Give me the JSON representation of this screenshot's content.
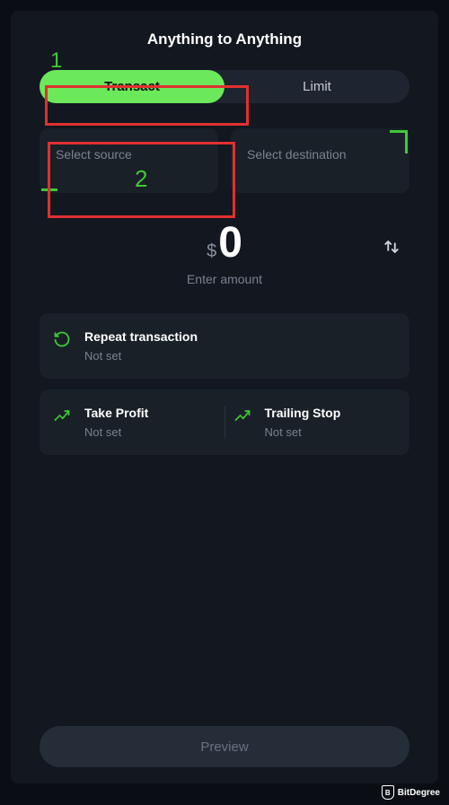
{
  "header": {
    "title": "Anything to Anything"
  },
  "annotations": {
    "one": "1",
    "two": "2"
  },
  "tabs": {
    "transact": "Transact",
    "limit": "Limit"
  },
  "selectors": {
    "source": "Select source",
    "destination": "Select destination"
  },
  "amount": {
    "currency": "$",
    "value": "0",
    "hint": "Enter amount"
  },
  "options": {
    "repeat": {
      "title": "Repeat transaction",
      "status": "Not set"
    },
    "takeProfit": {
      "title": "Take Profit",
      "status": "Not set"
    },
    "trailingStop": {
      "title": "Trailing Stop",
      "status": "Not set"
    }
  },
  "preview": "Preview",
  "watermark": "BitDegree"
}
